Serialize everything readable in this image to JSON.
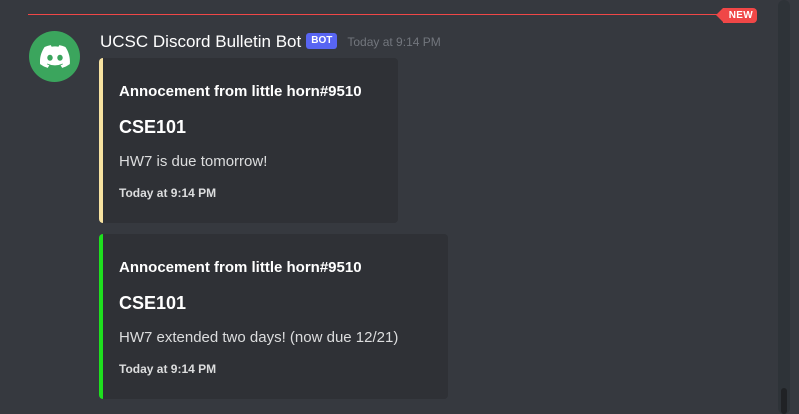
{
  "divider": {
    "new_label": "NEW",
    "color": "#f04747"
  },
  "message": {
    "avatar_icon": "discord-logo-icon",
    "avatar_color": "#3ba55d",
    "username": "UCSC Discord Bulletin Bot",
    "bot_tag": "BOT",
    "timestamp": "Today at 9:14 PM"
  },
  "embeds": [
    {
      "accent_color": "#f8e3a1",
      "author": "Annocement from little horn#9510",
      "title": "CSE101",
      "description": "HW7 is due tomorrow!",
      "footer": "Today at 9:14 PM"
    },
    {
      "accent_color": "#1ee01e",
      "author": "Annocement from little horn#9510",
      "title": "CSE101",
      "description": "HW7 extended two days! (now due 12/21)",
      "footer": "Today at 9:14 PM"
    }
  ]
}
